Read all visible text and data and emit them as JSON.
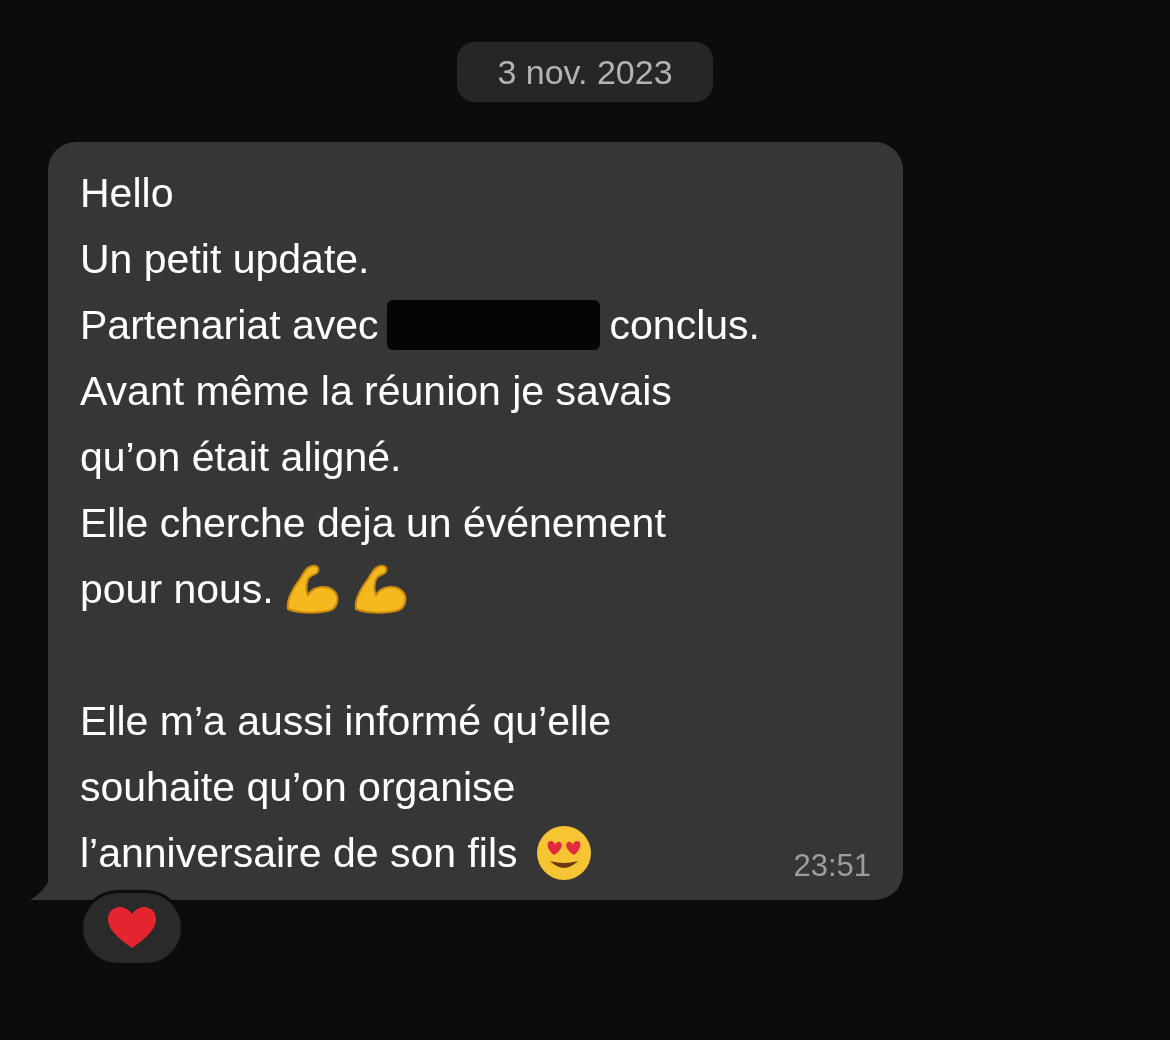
{
  "date": "3 nov. 2023",
  "message": {
    "paragraphs": [
      [
        [
          {
            "kind": "text",
            "text": "Hello"
          }
        ],
        [
          {
            "kind": "text",
            "text": "Un petit update."
          }
        ],
        [
          {
            "kind": "text",
            "text": "Partenariat avec"
          },
          {
            "kind": "redaction"
          },
          {
            "kind": "text",
            "text": "conclus."
          }
        ],
        [
          {
            "kind": "text",
            "text": "Avant même la réunion je savais"
          }
        ],
        [
          {
            "kind": "text",
            "text": "qu’on était aligné."
          }
        ],
        [
          {
            "kind": "text",
            "text": "Elle cherche deja un événement"
          }
        ],
        [
          {
            "kind": "text",
            "text": "pour nous."
          },
          {
            "kind": "muscle"
          },
          {
            "kind": "muscle"
          }
        ]
      ],
      [
        [
          {
            "kind": "text",
            "text": "Elle m’a aussi informé qu’elle"
          }
        ],
        [
          {
            "kind": "text",
            "text": "souhaite qu’on organise"
          }
        ],
        [
          {
            "kind": "text",
            "text": "l’anniversaire de son fils"
          },
          {
            "kind": "hearteyes"
          }
        ]
      ]
    ],
    "time": "23:51",
    "reactions": [
      {
        "kind": "heart"
      }
    ]
  }
}
